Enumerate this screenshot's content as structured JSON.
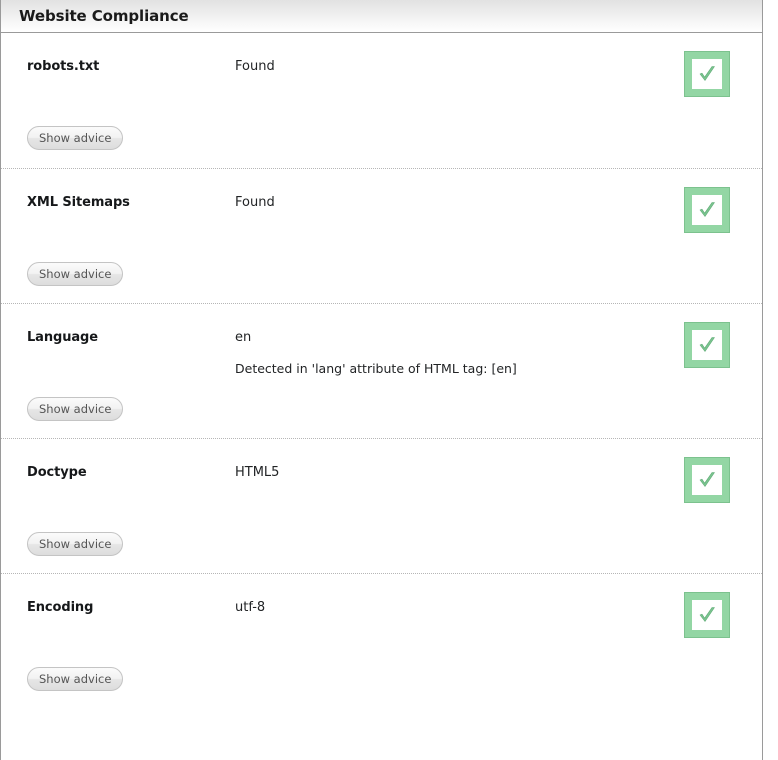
{
  "panel": {
    "title": "Website Compliance"
  },
  "common": {
    "advice_button_label": "Show advice",
    "status_icon_name": "green-check-icon",
    "accent_green": "#93d6a4",
    "accent_green_border": "#7cc28e",
    "check_stroke": "#6bbf85",
    "header_gradient_top": "#e2e2e2",
    "header_gradient_bottom": "#ffffff",
    "panel_border": "#9a9a9a",
    "divider_color": "#b6b6b6"
  },
  "rows": [
    {
      "label": "robots.txt",
      "value": "Found",
      "detail": "",
      "status": "pass",
      "advice_label": "Show advice"
    },
    {
      "label": "XML Sitemaps",
      "value": "Found",
      "detail": "",
      "status": "pass",
      "advice_label": "Show advice"
    },
    {
      "label": "Language",
      "value": "en",
      "detail": "Detected in 'lang' attribute of HTML tag: [en]",
      "status": "pass",
      "advice_label": "Show advice"
    },
    {
      "label": "Doctype",
      "value": "HTML5",
      "detail": "",
      "status": "pass",
      "advice_label": "Show advice"
    },
    {
      "label": "Encoding",
      "value": "utf-8",
      "detail": "",
      "status": "pass",
      "advice_label": "Show advice"
    }
  ]
}
